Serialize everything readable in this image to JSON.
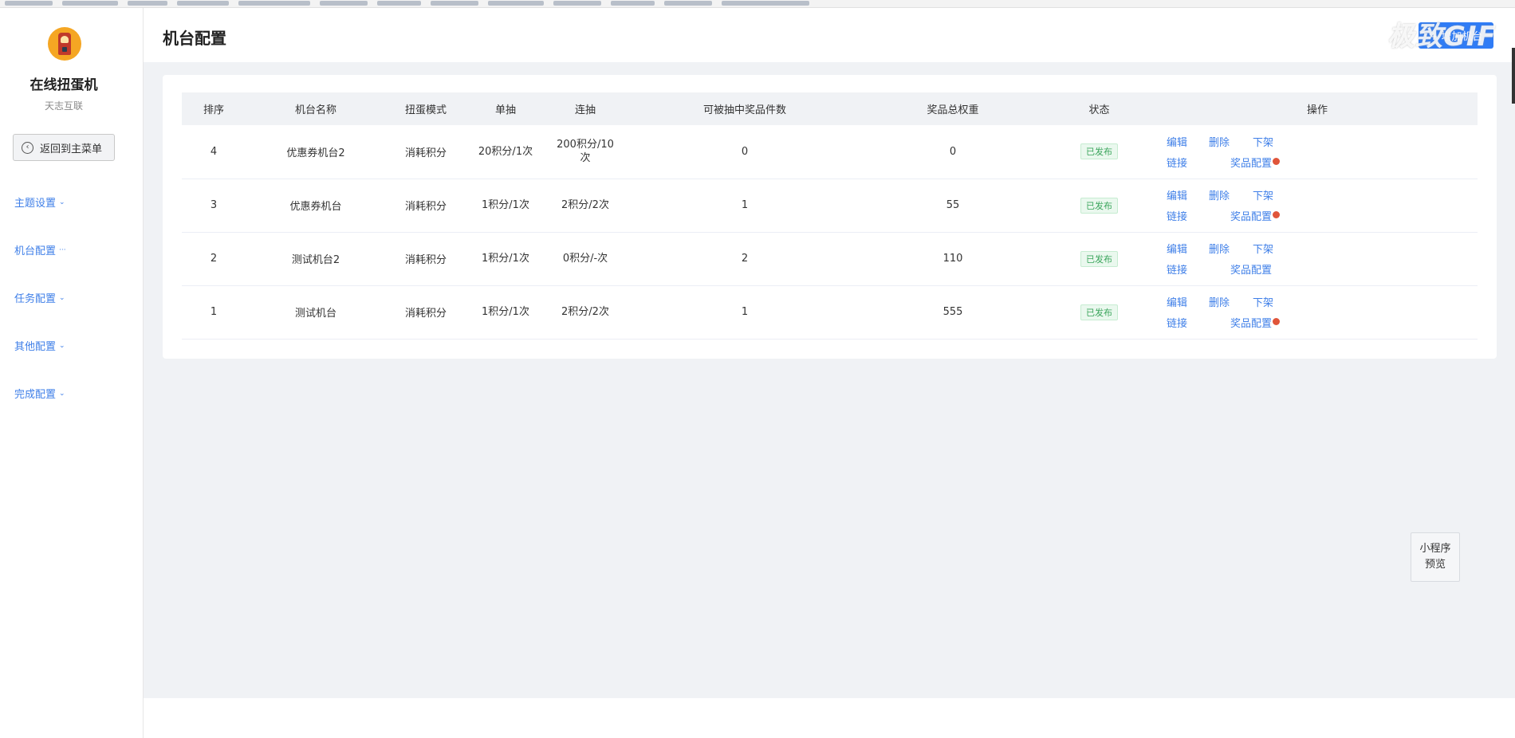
{
  "sidebar": {
    "app_name": "在线扭蛋机",
    "app_sub": "天志互联",
    "back_label": "返回到主菜单",
    "nav": [
      {
        "label": "主题设置",
        "suffix": "⌄"
      },
      {
        "label": "机台配置",
        "suffix": "···"
      },
      {
        "label": "任务配置",
        "suffix": "⌄"
      },
      {
        "label": "其他配置",
        "suffix": "⌄"
      },
      {
        "label": "完成配置",
        "suffix": "⌄"
      }
    ]
  },
  "header": {
    "title": "机台配置",
    "add_button": "+ 增加机台",
    "watermark": "极致GIF"
  },
  "table": {
    "columns": [
      "排序",
      "机台名称",
      "扭蛋模式",
      "单抽",
      "连抽",
      "可被抽中奖品件数",
      "奖品总权重",
      "状态",
      "操作"
    ],
    "rows": [
      {
        "order": "4",
        "name": "优惠券机台2",
        "mode": "消耗积分",
        "single": "20积分/1次",
        "multi": "200积分/10次",
        "count": "0",
        "weight": "0",
        "status": "已发布",
        "dot": true
      },
      {
        "order": "3",
        "name": "优惠券机台",
        "mode": "消耗积分",
        "single": "1积分/1次",
        "multi": "2积分/2次",
        "count": "1",
        "weight": "55",
        "status": "已发布",
        "dot": true
      },
      {
        "order": "2",
        "name": "测试机台2",
        "mode": "消耗积分",
        "single": "1积分/1次",
        "multi": "0积分/-次",
        "count": "2",
        "weight": "110",
        "status": "已发布",
        "dot": false
      },
      {
        "order": "1",
        "name": "测试机台",
        "mode": "消耗积分",
        "single": "1积分/1次",
        "multi": "2积分/2次",
        "count": "1",
        "weight": "555",
        "status": "已发布",
        "dot": true
      }
    ],
    "actions": {
      "edit": "编辑",
      "delete": "删除",
      "unpublish": "下架",
      "link": "链接",
      "prize": "奖品配置"
    }
  },
  "preview": {
    "line1": "小程序",
    "line2": "预览"
  },
  "colors": {
    "accent": "#2f7cf6",
    "link": "#3f7fe8",
    "published": "#3ba55c",
    "dot": "#e0553a"
  }
}
